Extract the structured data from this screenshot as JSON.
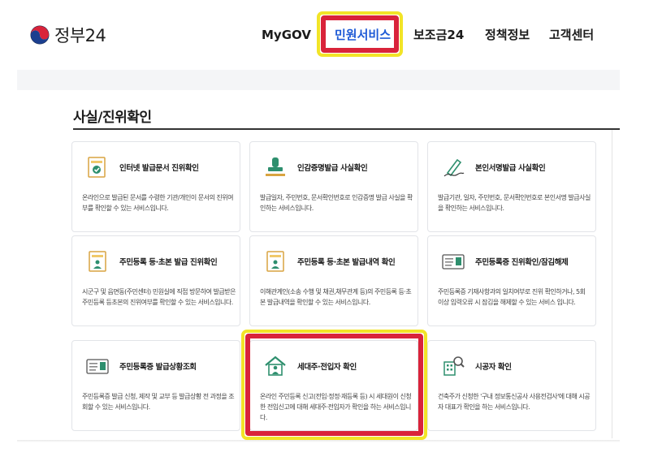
{
  "header": {
    "logo_text": "정부24",
    "nav": [
      "MyGOV",
      "민원서비스",
      "보조금24",
      "정책정보",
      "고객센터"
    ],
    "active_nav": "민원서비스"
  },
  "section": {
    "title": "사실/진위확인"
  },
  "cards": [
    {
      "title": "인터넷 발급문서 진위확인",
      "desc": "온라인으로 발급된 문서를 수령한 기관/개인이 문서의 진위여부를 확인할 수 있는 서비스입니다.",
      "icon": "document-check-icon"
    },
    {
      "title": "인감증명발급 사실확인",
      "desc": "발급일자, 주민번호, 문서확인번호로 인감증명 발급 사실을 확인하는 서비스입니다.",
      "icon": "seal-stamp-icon"
    },
    {
      "title": "본인서명발급 사실확인",
      "desc": "발급기관, 일자, 주민번호, 문서확인번호로 본인서명 발급사실을 확인하는 서비스입니다.",
      "icon": "signature-pen-icon"
    },
    {
      "title": "주민등록 등·초본 발급 진위확인",
      "desc": "시군구 및 읍면동(주민센터) 민원실에 직접 방문하여 발급받은 주민등록 등초본의 진위여부를 확인할 수 있는 서비스입니다.",
      "icon": "resident-doc-icon"
    },
    {
      "title": "주민등록 등·초본 발급내역 확인",
      "desc": "이해관계인(소송 수행 및 채권,채무관계 등)의 주민등록 등·초본 발급내역을 확인할 수 있는 서비스입니다.",
      "icon": "resident-doc-history-icon"
    },
    {
      "title": "주민등록증 진위확인/잠김해제",
      "desc": "주민등록증 기재사항과의 일치여부로 진위 확인하거나, 5회 이상 입력오류 시 잠김을 해제할 수 있는 서비스 입니다.",
      "icon": "id-card-icon"
    },
    {
      "title": "주민등록증 발급상황조회",
      "desc": "주민등록증 발급 신청, 제작 및 교부 등 발급상황 전 과정을 조회할 수 있는 서비스입니다.",
      "icon": "id-card-status-icon"
    },
    {
      "title": "세대주·전입자 확인",
      "desc": "온라인 주민등록 신고(전입·정정·재등록 등) 시 세대원이 신청한 전입신고에 대해 세대주·전입자가 확인을 하는 서비스입니다.",
      "icon": "house-person-icon"
    },
    {
      "title": "시공자 확인",
      "desc": "건축주가 신청한 '구내 정보통신공사 사용전검사'에 대해 시공자 대표가 확인을 하는 서비스입니다.",
      "icon": "building-search-icon"
    }
  ],
  "colors": {
    "accent": "#1f5bd6",
    "highlight_red": "#d9233a",
    "highlight_yellow": "#f2e427",
    "icon_green": "#2e8f6e"
  }
}
